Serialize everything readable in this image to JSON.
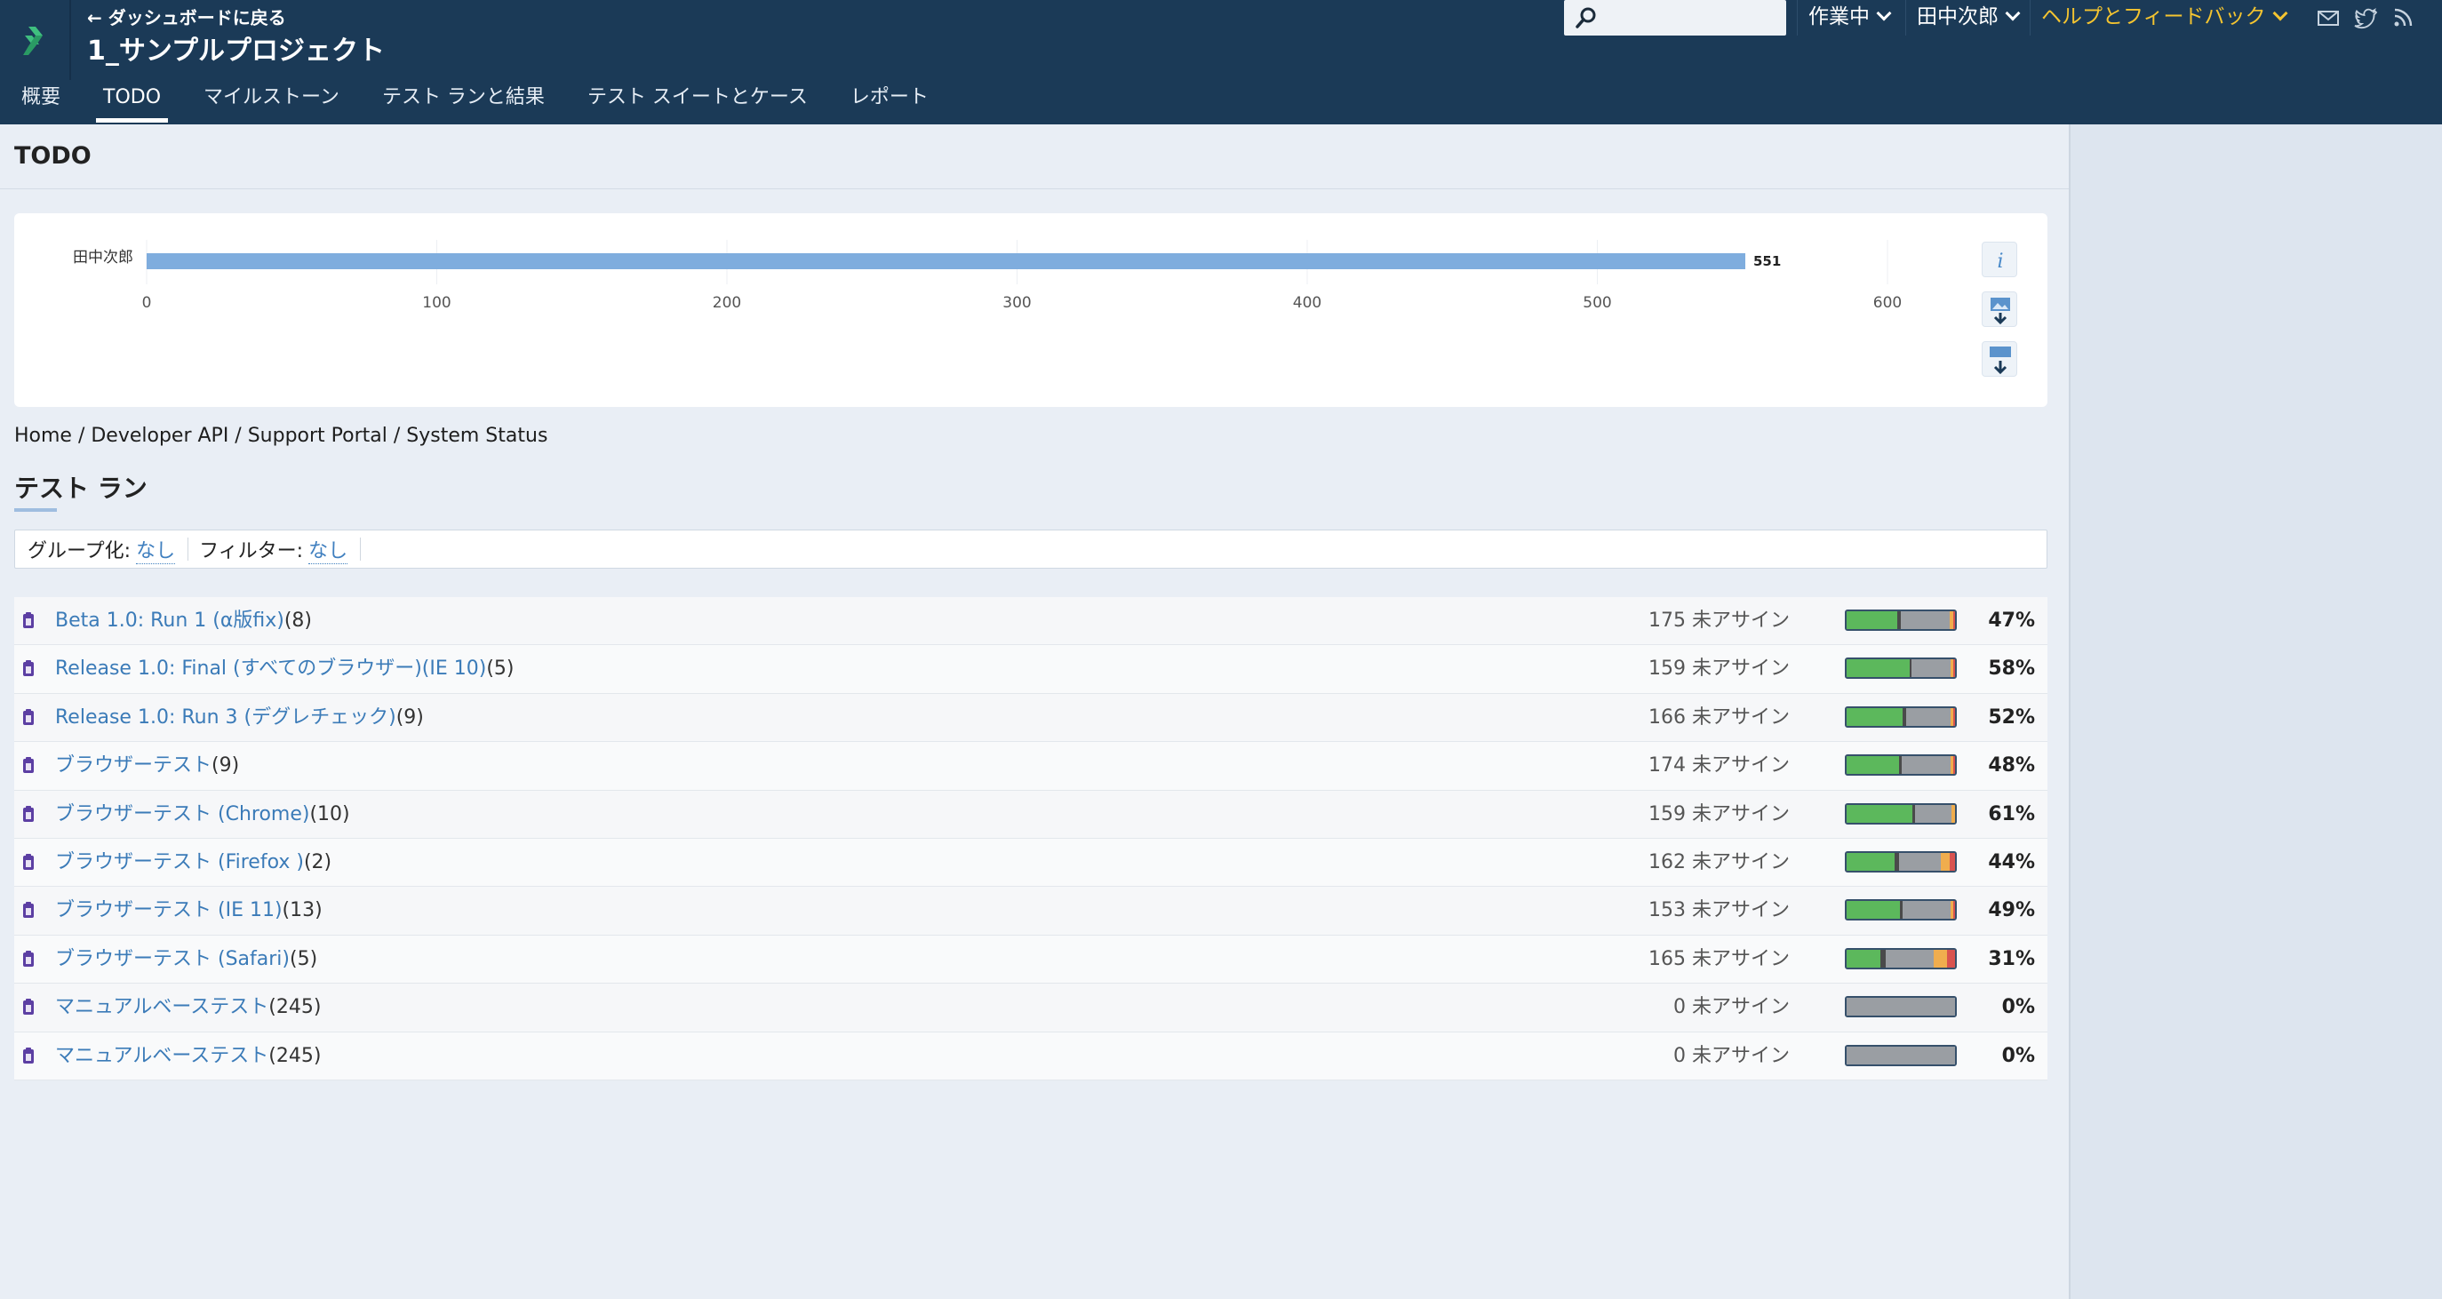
{
  "header": {
    "back_label": "← ダッシュボードに戻る",
    "project_title": "1_サンプルプロジェクト",
    "tabs": [
      {
        "label": "概要"
      },
      {
        "label": "TODO"
      },
      {
        "label": "マイルストーン"
      },
      {
        "label": "テスト ランと結果"
      },
      {
        "label": "テスト スイートとケース"
      },
      {
        "label": "レポート"
      }
    ],
    "active_tab": "TODO",
    "search_placeholder": "",
    "status_dropdown": "作業中",
    "user_dropdown": "田中次郎",
    "help_dropdown": "ヘルプとフィードバック",
    "accent_color": "#f4c430",
    "header_color": "#1b3a57"
  },
  "page": {
    "heading": "TODO"
  },
  "chart_data": {
    "type": "bar",
    "orientation": "horizontal",
    "categories": [
      "田中次郎"
    ],
    "values": [
      551
    ],
    "value_labels": [
      "551"
    ],
    "xlim": [
      0,
      600
    ],
    "xticks": [
      "0",
      "100",
      "200",
      "300",
      "400",
      "500",
      "600"
    ],
    "grid": true,
    "bar_color": "#7fadde"
  },
  "breadcrumb": "Home / Developer API / Support Portal / System Status",
  "section": {
    "title": "テスト ラン"
  },
  "filters": {
    "group_label": "グループ化:",
    "group_value": "なし",
    "filter_label": "フィルター:",
    "filter_value": "なし"
  },
  "status_colors": {
    "passed": "#5cb85c",
    "untested": "#9a9ea3",
    "blocked": "#4a4a4a",
    "retest": "#f0ad4e",
    "failed": "#d9534f"
  },
  "runs": [
    {
      "name": "Beta 1.0: Run 1 (α版fix)",
      "count": "(8)",
      "unassigned": "175 未アサイン",
      "percent": "47%",
      "passed": 47,
      "blocked": 3,
      "untested": 45,
      "retest": 3,
      "failed": 2
    },
    {
      "name": "Release 1.0: Final (すべてのブラウザー)(IE 10)",
      "count": "(5)",
      "unassigned": "159 未アサイン",
      "percent": "58%",
      "passed": 58,
      "blocked": 2,
      "untested": 36,
      "retest": 2,
      "failed": 2
    },
    {
      "name": "Release 1.0: Run 3 (デグレチェック)",
      "count": "(9)",
      "unassigned": "166 未アサイン",
      "percent": "52%",
      "passed": 52,
      "blocked": 3,
      "untested": 41,
      "retest": 2,
      "failed": 2
    },
    {
      "name": "ブラウザーテスト",
      "count": "(9)",
      "unassigned": "174 未アサイン",
      "percent": "48%",
      "passed": 48,
      "blocked": 3,
      "untested": 45,
      "retest": 2,
      "failed": 2
    },
    {
      "name": "ブラウザーテスト (Chrome)",
      "count": "(10)",
      "unassigned": "159 未アサイン",
      "percent": "61%",
      "passed": 61,
      "blocked": 2,
      "untested": 34,
      "retest": 3,
      "failed": 0
    },
    {
      "name": "ブラウザーテスト (Firefox )",
      "count": "(2)",
      "unassigned": "162 未アサイン",
      "percent": "44%",
      "passed": 44,
      "blocked": 4,
      "untested": 39,
      "retest": 8,
      "failed": 5
    },
    {
      "name": "ブラウザーテスト (IE 11)",
      "count": "(13)",
      "unassigned": "153 未アサイン",
      "percent": "49%",
      "passed": 49,
      "blocked": 3,
      "untested": 44,
      "retest": 2,
      "failed": 2
    },
    {
      "name": "ブラウザーテスト (Safari)",
      "count": "(5)",
      "unassigned": "165 未アサイン",
      "percent": "31%",
      "passed": 31,
      "blocked": 5,
      "untested": 44,
      "retest": 13,
      "failed": 7
    },
    {
      "name": "マニュアルベーステスト",
      "count": "(245)",
      "unassigned": "0 未アサイン",
      "percent": "0%",
      "passed": 0,
      "blocked": 0,
      "untested": 100,
      "retest": 0,
      "failed": 0
    },
    {
      "name": "マニュアルベーステスト",
      "count": "(245)",
      "unassigned": "0 未アサイン",
      "percent": "0%",
      "passed": 0,
      "blocked": 0,
      "untested": 100,
      "retest": 0,
      "failed": 0
    }
  ]
}
